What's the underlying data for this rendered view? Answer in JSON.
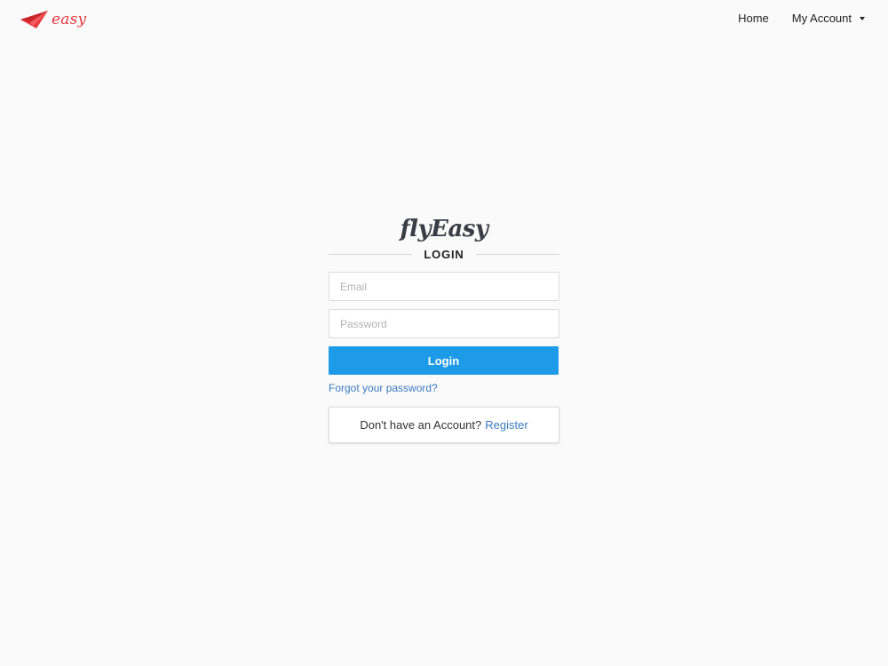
{
  "header": {
    "logo_text": "easy",
    "logo_icon": "paper-plane-icon",
    "accent_color": "#e8353b",
    "nav": {
      "home_label": "Home",
      "account_label": "My Account"
    }
  },
  "login": {
    "brand": "flyEasy",
    "heading": "LOGIN",
    "email_placeholder": "Email",
    "password_placeholder": "Password",
    "submit_label": "Login",
    "submit_color": "#1e9be8",
    "forgot_label": "Forgot your password?",
    "register_prompt": "Don't have an Account?",
    "register_label": "Register",
    "link_color": "#3a7bbf"
  }
}
